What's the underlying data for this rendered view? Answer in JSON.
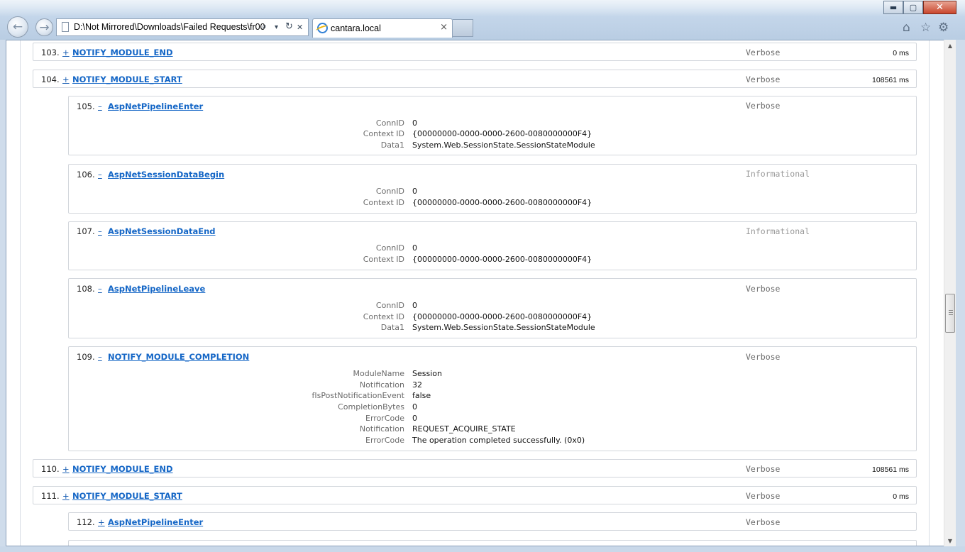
{
  "browser": {
    "address_url": "D:\\Not Mirrored\\Downloads\\Failed Requests\\fr00",
    "tab_title": "cantara.local",
    "tab_close": "×",
    "back_glyph": "←",
    "forward_glyph": "→",
    "address_tools": {
      "search": "⌕",
      "dropdown": "▾",
      "refresh": "↻",
      "stop": "✕"
    },
    "window_controls": {
      "minimize": "▬",
      "maximize": "▢",
      "close": "✕"
    },
    "right_tools": {
      "home": "⌂",
      "favorites": "☆",
      "settings": "⚙"
    }
  },
  "events": [
    {
      "num": "103.",
      "toggle": "+",
      "name": "NOTIFY_MODULE_END",
      "level": "Verbose",
      "duration": "0 ms"
    },
    {
      "num": "104.",
      "toggle": "+",
      "name": "NOTIFY_MODULE_START",
      "level": "Verbose",
      "duration": "108561 ms"
    },
    {
      "num": "105.",
      "toggle": "–",
      "name": "AspNetPipelineEnter",
      "level": "Verbose",
      "details": [
        {
          "key": "ConnID",
          "value": "0"
        },
        {
          "key": "Context ID",
          "value": "{00000000-0000-0000-2600-0080000000F4}"
        },
        {
          "key": "Data1",
          "value": "System.Web.SessionState.SessionStateModule"
        }
      ]
    },
    {
      "num": "106.",
      "toggle": "–",
      "name": "AspNetSessionDataBegin",
      "level": "Informational",
      "details": [
        {
          "key": "ConnID",
          "value": "0"
        },
        {
          "key": "Context ID",
          "value": "{00000000-0000-0000-2600-0080000000F4}"
        }
      ]
    },
    {
      "num": "107.",
      "toggle": "–",
      "name": "AspNetSessionDataEnd",
      "level": "Informational",
      "details": [
        {
          "key": "ConnID",
          "value": "0"
        },
        {
          "key": "Context ID",
          "value": "{00000000-0000-0000-2600-0080000000F4}"
        }
      ]
    },
    {
      "num": "108.",
      "toggle": "–",
      "name": "AspNetPipelineLeave",
      "level": "Verbose",
      "details": [
        {
          "key": "ConnID",
          "value": "0"
        },
        {
          "key": "Context ID",
          "value": "{00000000-0000-0000-2600-0080000000F4}"
        },
        {
          "key": "Data1",
          "value": "System.Web.SessionState.SessionStateModule"
        }
      ]
    },
    {
      "num": "109.",
      "toggle": "–",
      "name": "NOTIFY_MODULE_COMPLETION",
      "level": "Verbose",
      "details": [
        {
          "key": "ModuleName",
          "value": "Session"
        },
        {
          "key": "Notification",
          "value": "32"
        },
        {
          "key": "fIsPostNotificationEvent",
          "value": "false"
        },
        {
          "key": "CompletionBytes",
          "value": "0"
        },
        {
          "key": "ErrorCode",
          "value": "0"
        },
        {
          "key": "Notification",
          "value": "REQUEST_ACQUIRE_STATE"
        },
        {
          "key": "ErrorCode",
          "value": "The operation completed successfully. (0x0)"
        }
      ]
    },
    {
      "num": "110.",
      "toggle": "+",
      "name": "NOTIFY_MODULE_END",
      "level": "Verbose",
      "duration": "108561 ms"
    },
    {
      "num": "111.",
      "toggle": "+",
      "name": "NOTIFY_MODULE_START",
      "level": "Verbose",
      "duration": "0 ms"
    },
    {
      "num": "112.",
      "toggle": "+",
      "name": "AspNetPipelineEnter",
      "level": "Verbose"
    }
  ],
  "scrollbar": {
    "up": "▲",
    "down": "▼",
    "position": 0.52
  }
}
